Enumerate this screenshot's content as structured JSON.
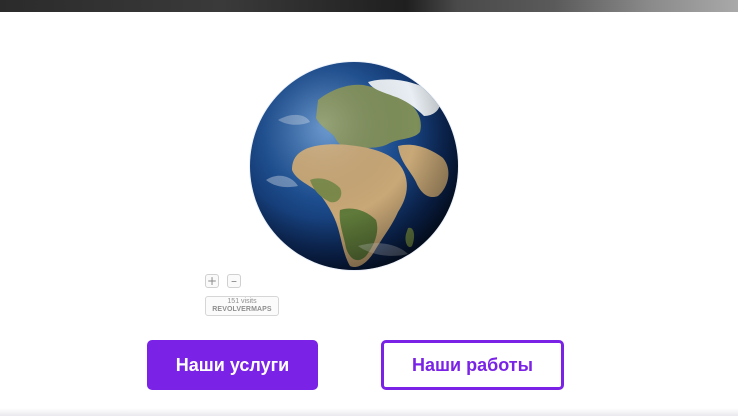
{
  "globe": {
    "widget": "revolvermap",
    "zoom_in": "+",
    "zoom_out": "–",
    "visits_text": "151 visits",
    "brand_text": "REVOLVERMAPS"
  },
  "actions": {
    "services_label": "Наши услуги",
    "works_label": "Наши работы"
  },
  "colors": {
    "accent": "#7a22e6",
    "ocean": "#163d7a",
    "land": "#c9a877"
  }
}
